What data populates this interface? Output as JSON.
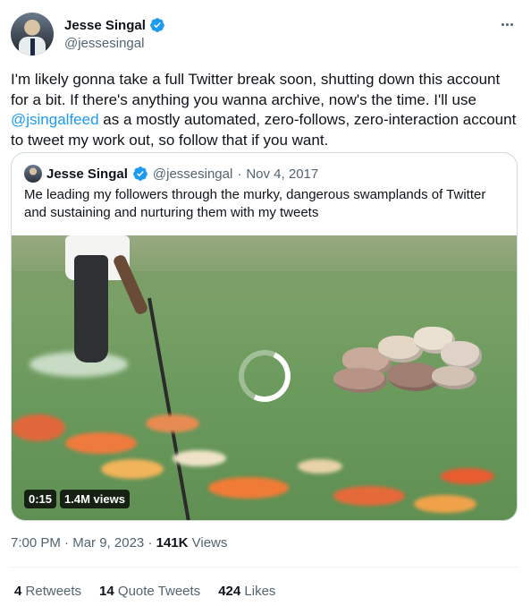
{
  "author": {
    "display_name": "Jesse Singal",
    "handle": "@jessesingal"
  },
  "tweet": {
    "text_before_mention": "I'm likely gonna take a full Twitter break soon, shutting down this account for a bit. If there's anything you wanna archive, now's the time. I'll use ",
    "mention": "@jsingalfeed",
    "text_after_mention": " as a mostly automated, zero-follows, zero-interaction account to tweet my work out, so follow that if you want."
  },
  "quoted_tweet": {
    "display_name": "Jesse Singal",
    "handle": "@jessesingal",
    "separator": "·",
    "date": "Nov 4, 2017",
    "text": "Me leading my followers through the murky, dangerous swamplands of Twitter and sustaining and nurturing them with my tweets",
    "video": {
      "duration": "0:15",
      "views": "1.4M views"
    }
  },
  "meta": {
    "time": "7:00 PM",
    "separator": "·",
    "date": "Mar 9, 2023",
    "views_count": "141K",
    "views_label": "Views"
  },
  "stats": [
    {
      "count": "4",
      "label": "Retweets"
    },
    {
      "count": "14",
      "label": "Quote Tweets"
    },
    {
      "count": "424",
      "label": "Likes"
    }
  ],
  "colors": {
    "link": "#1d9bf0",
    "verified": "#1d9bf0",
    "secondary_text": "#536471"
  },
  "icons": [
    "verified-badge-icon",
    "more-options-icon",
    "loading-spinner-icon"
  ]
}
